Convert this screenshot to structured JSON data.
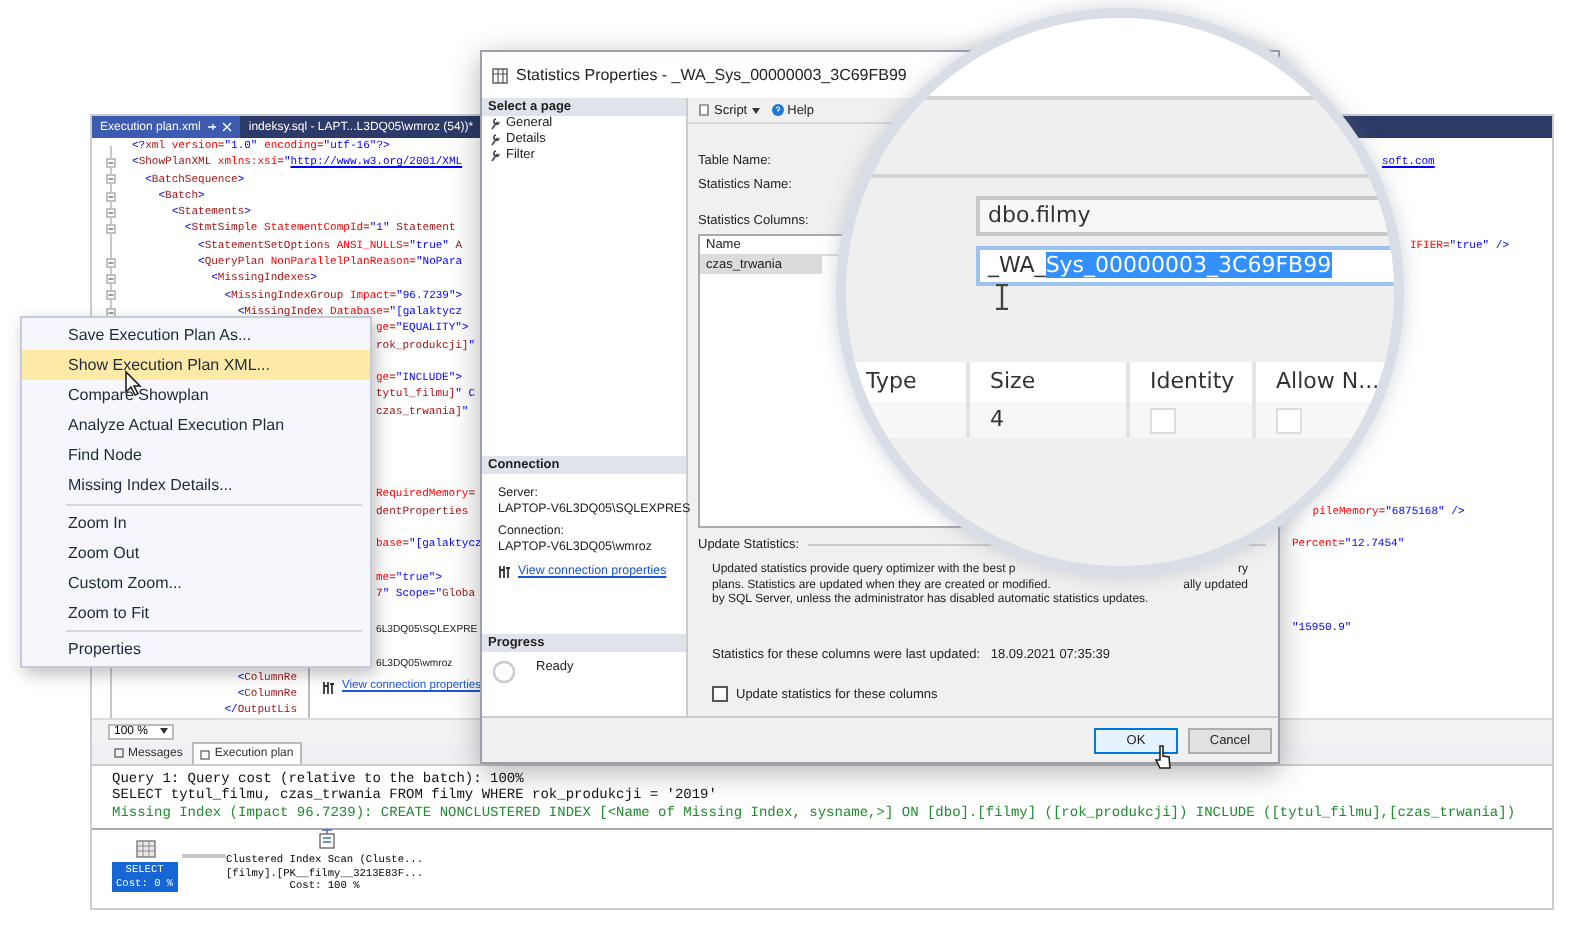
{
  "editor": {
    "tabs": [
      {
        "label": "Execution plan.xml",
        "selected": true,
        "closable": true
      },
      {
        "label": "indeksy.sql - LAPT...L3DQ05\\wmroz (54))*",
        "selected": false,
        "closable": false
      }
    ],
    "lines": [
      {
        "kind": "code",
        "text": "<?xml version=\"1.0\" encoding=\"utf-16\"?>",
        "fold": false
      },
      {
        "kind": "code",
        "text": "<ShowPlanXML xmlns:xsi=\"",
        "link": "http://www.w3.org/2001/XML",
        "fold": true,
        "tail": {
          "text": "soft.com",
          "link": true
        }
      },
      {
        "kind": "code",
        "text": "  <BatchSequence>",
        "fold": true
      },
      {
        "kind": "code",
        "text": "    <Batch>",
        "fold": true
      },
      {
        "kind": "code",
        "text": "      <Statements>",
        "fold": true
      },
      {
        "kind": "code",
        "text": "        <StmtSimple StatementCompId=\"1\" Statement",
        "fold": true
      },
      {
        "kind": "code",
        "text": "          <StatementSetOptions ANSI_NULLS=\"true\" A",
        "fold": false,
        "tail": {
          "text": "IFIER=\"true\" />",
          "link": false
        }
      },
      {
        "kind": "code",
        "text": "          <QueryPlan NonParallelPlanReason=\"NoPara",
        "fold": true
      },
      {
        "kind": "code",
        "text": "            <MissingIndexes>",
        "fold": true
      },
      {
        "kind": "code",
        "text": "              <MissingIndexGroup Impact=\"96.7239\">",
        "fold": true
      },
      {
        "kind": "code",
        "text": "                <MissingIndex Database=\"[galaktycz",
        "fold": true
      },
      {
        "kind": "covered",
        "text": "ge=\"EQUALITY\">"
      },
      {
        "kind": "covered",
        "text": "rok_produkcji]\""
      },
      {
        "kind": "covered"
      },
      {
        "kind": "covered",
        "text": "ge=\"INCLUDE\">"
      },
      {
        "kind": "covered",
        "text": "tytul_filmu]\" C"
      },
      {
        "kind": "covered",
        "text": "czas_trwania]\""
      },
      {
        "kind": "covered"
      },
      {
        "kind": "covered"
      },
      {
        "kind": "covered"
      },
      {
        "kind": "covered"
      },
      {
        "kind": "covered",
        "text": "RequiredMemory="
      },
      {
        "kind": "covered",
        "text": "dentProperties",
        "tail": {
          "text": "pileMemory=\"6875168\" />",
          "link": false
        }
      },
      {
        "kind": "covered"
      },
      {
        "kind": "covered",
        "text": "base=\"[galaktycz",
        "tail": {
          "text": "Percent=\"12.7454\"",
          "link": false
        }
      },
      {
        "kind": "covered"
      },
      {
        "kind": "covered",
        "text": "me=\"true\">"
      },
      {
        "kind": "covered",
        "text": "7\" Scope=\"Globa"
      },
      {
        "kind": "covered"
      },
      {
        "kind": "covered",
        "tail": {
          "text": "\"15950.9\"",
          "link": false
        }
      },
      {
        "kind": "covered"
      },
      {
        "kind": "covered"
      },
      {
        "kind": "code",
        "text": "                <ColumnRe",
        "fold": false
      },
      {
        "kind": "code",
        "text": "                <ColumnRe",
        "fold": false
      },
      {
        "kind": "code",
        "text": "              </OutputLis",
        "fold": false
      }
    ],
    "ghost_connection": {
      "server": "6L3DQ05\\SQLEXPRE",
      "connection": "6L3DQ05\\wmroz",
      "link": "View connection properties"
    },
    "zoom": "100 %",
    "result_tabs": [
      {
        "label": "Messages",
        "selected": false
      },
      {
        "label": "Execution plan",
        "selected": true
      }
    ],
    "query_lines": [
      {
        "kind": "text",
        "text": "Query 1: Query cost (relative to the batch): 100%"
      },
      {
        "kind": "text",
        "text": "SELECT tytul_filmu, czas_trwania FROM filmy WHERE rok_produkcji = '2019'"
      },
      {
        "kind": "hint",
        "text": "Missing Index (Impact 96.7239): CREATE NONCLUSTERED INDEX [<Name of Missing Index, sysname,>] ON [dbo].[filmy] ([rok_produkcji]) INCLUDE ([tytul_filmu],[czas_trwania])"
      }
    ],
    "plan": {
      "select": {
        "label": "SELECT",
        "cost": "Cost: 0 %",
        "selected": true
      },
      "scan": {
        "lines": [
          "Clustered Index Scan (Cluste...",
          "[filmy].[PK__filmy__3213E83F...",
          "Cost: 100 %"
        ]
      }
    }
  },
  "context_menu": {
    "groups": [
      [
        {
          "label": "Save Execution Plan As...",
          "selected": false
        },
        {
          "label": "Show Execution Plan XML...",
          "selected": true
        },
        {
          "label": "Compare Showplan",
          "selected": false
        },
        {
          "label": "Analyze Actual Execution Plan",
          "selected": false
        },
        {
          "label": "Find Node",
          "selected": false
        },
        {
          "label": "Missing Index Details...",
          "selected": false
        }
      ],
      [
        {
          "label": "Zoom In",
          "selected": false
        },
        {
          "label": "Zoom Out",
          "selected": false
        },
        {
          "label": "Custom Zoom...",
          "selected": false
        },
        {
          "label": "Zoom to Fit",
          "selected": false
        }
      ],
      [
        {
          "label": "Properties",
          "selected": false
        }
      ]
    ]
  },
  "dialog": {
    "title": "Statistics Properties - _WA_Sys_00000003_3C69FB99",
    "select_page": {
      "header": "Select a page",
      "pages": [
        "General",
        "Details",
        "Filter"
      ]
    },
    "connection": {
      "header": "Connection",
      "server_label": "Server:",
      "server": "LAPTOP-V6L3DQ05\\SQLEXPRES",
      "connection_label": "Connection:",
      "connection": "LAPTOP-V6L3DQ05\\wmroz",
      "link": "View connection properties"
    },
    "progress": {
      "header": "Progress",
      "status": "Ready"
    },
    "toolbar": {
      "script": "Script",
      "help": "Help"
    },
    "labels": {
      "table_name": "Table Name:",
      "statistics_name": "Statistics Name:",
      "statistics_columns": "Statistics Columns:"
    },
    "columns_grid": {
      "header": "Name",
      "rows": [
        {
          "name": "czas_trwania",
          "selected": true
        }
      ]
    },
    "update": {
      "group_label": "Update Statistics:",
      "paragraph": [
        {
          "text": "Updated statistics provide query optimizer with the best p",
          "tail": "ry"
        },
        {
          "text": "plans. Statistics are updated when they are created or modified.",
          "tail": "ally updated"
        },
        {
          "text": "by SQL Server, unless the administrator has disabled automatic statistics updates."
        }
      ],
      "last_updated_label": "Statistics for these columns were last updated:",
      "last_updated": "18.09.2021 07:35:39",
      "checkbox": {
        "label": "Update statistics for these columns",
        "checked": false
      }
    },
    "buttons": [
      {
        "label": "OK",
        "focused": true
      },
      {
        "label": "Cancel",
        "focused": false
      }
    ]
  },
  "magnifier": {
    "table_name": "dbo.filmy",
    "statistics_name": [
      {
        "text": "_WA_",
        "selected": false
      },
      {
        "text": "Sys_00000003_3C69FB99",
        "selected": true
      }
    ],
    "columns": [
      "Type",
      "Size",
      "Identity",
      "Allow N..."
    ],
    "row": {
      "size": "4",
      "identity": false,
      "allow_nulls": false
    }
  }
}
